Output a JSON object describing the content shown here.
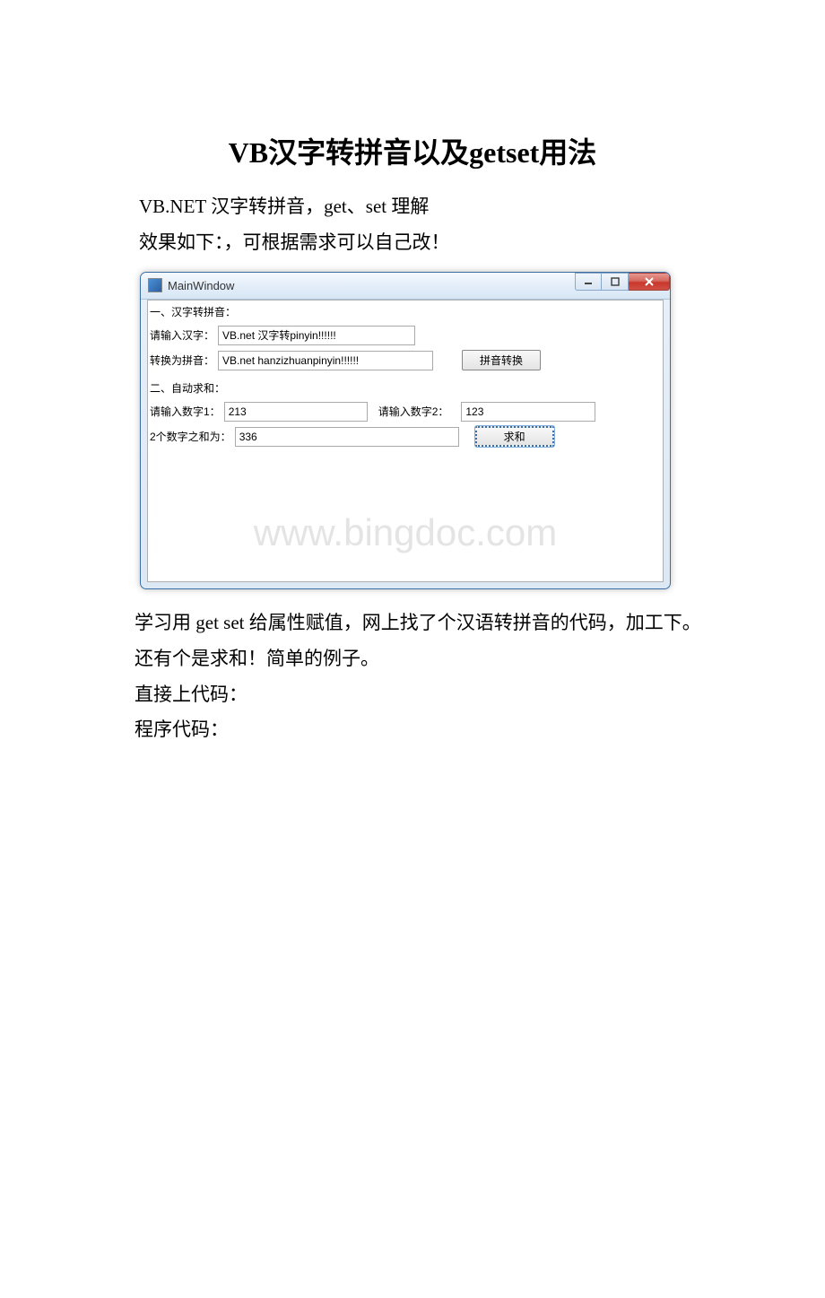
{
  "page_title": "VB汉字转拼音以及getset用法",
  "intro_line1": "VB.NET 汉字转拼音，get、set 理解",
  "intro_line2": "效果如下：，可根据需求可以自己改！",
  "window": {
    "title": "MainWindow",
    "section1_label": "一、汉字转拼音：",
    "hanzi_label": "请输入汉字：",
    "hanzi_value": "VB.net 汉字转pinyin!!!!!!",
    "pinyin_label": "转换为拼音：",
    "pinyin_value": "VB.net hanzizhuanpinyin!!!!!!",
    "convert_btn": "拼音转换",
    "section2_label": "二、自动求和：",
    "num1_label": "请输入数字1：",
    "num1_value": "213",
    "num2_label": "请输入数字2：",
    "num2_value": "123",
    "sum_label": "2个数字之和为：",
    "sum_value": "336",
    "sum_btn": "求和",
    "watermark": "www.bingdoc.com"
  },
  "para1": "学习用 get set 给属性赋值，网上找了个汉语转拼音的代码，加工下。",
  "para2": "还有个是求和！简单的例子。",
  "para3": "直接上代码：",
  "para4": "程序代码："
}
